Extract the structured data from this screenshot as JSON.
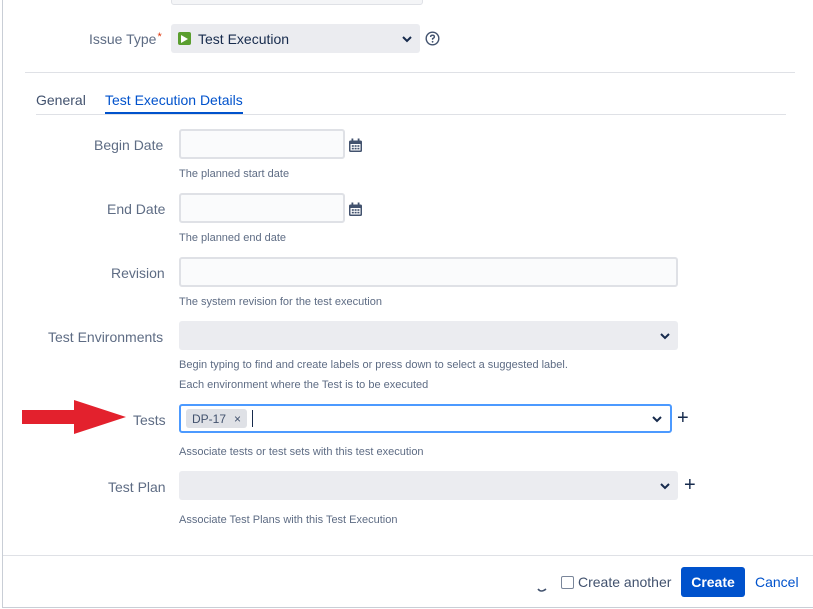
{
  "issue_type": {
    "label": "Issue Type",
    "required_mark": "*",
    "value": "Test Execution",
    "icon": "play-icon",
    "help_icon": "question-circle-icon"
  },
  "tabs": [
    {
      "label": "General",
      "active": false
    },
    {
      "label": "Test Execution Details",
      "active": true
    }
  ],
  "fields": {
    "begin_date": {
      "label": "Begin Date",
      "value": "",
      "description": "The planned start date",
      "icon": "calendar-icon"
    },
    "end_date": {
      "label": "End Date",
      "value": "",
      "description": "The planned end date",
      "icon": "calendar-icon"
    },
    "revision": {
      "label": "Revision",
      "value": "",
      "description": "The system revision for the test execution"
    },
    "test_environments": {
      "label": "Test Environments",
      "value": "",
      "description_line1": "Begin typing to find and create labels or press down to select a suggested label.",
      "description_line2": "Each environment where the Test is to be executed"
    },
    "tests": {
      "label": "Tests",
      "tags": [
        "DP-17"
      ],
      "remove_glyph": "×",
      "add_glyph": "+",
      "description": "Associate tests or test sets with this test execution"
    },
    "test_plan": {
      "label": "Test Plan",
      "value": "",
      "add_glyph": "+",
      "description": "Associate Test Plans with this Test Execution"
    }
  },
  "footer": {
    "create_another_label": "Create another",
    "create_another_checked": false,
    "create_label": "Create",
    "cancel_label": "Cancel"
  },
  "colors": {
    "primary": "#0052cc",
    "annotation_arrow": "#e3212d",
    "issue_type_icon": "#5a9e2f"
  }
}
